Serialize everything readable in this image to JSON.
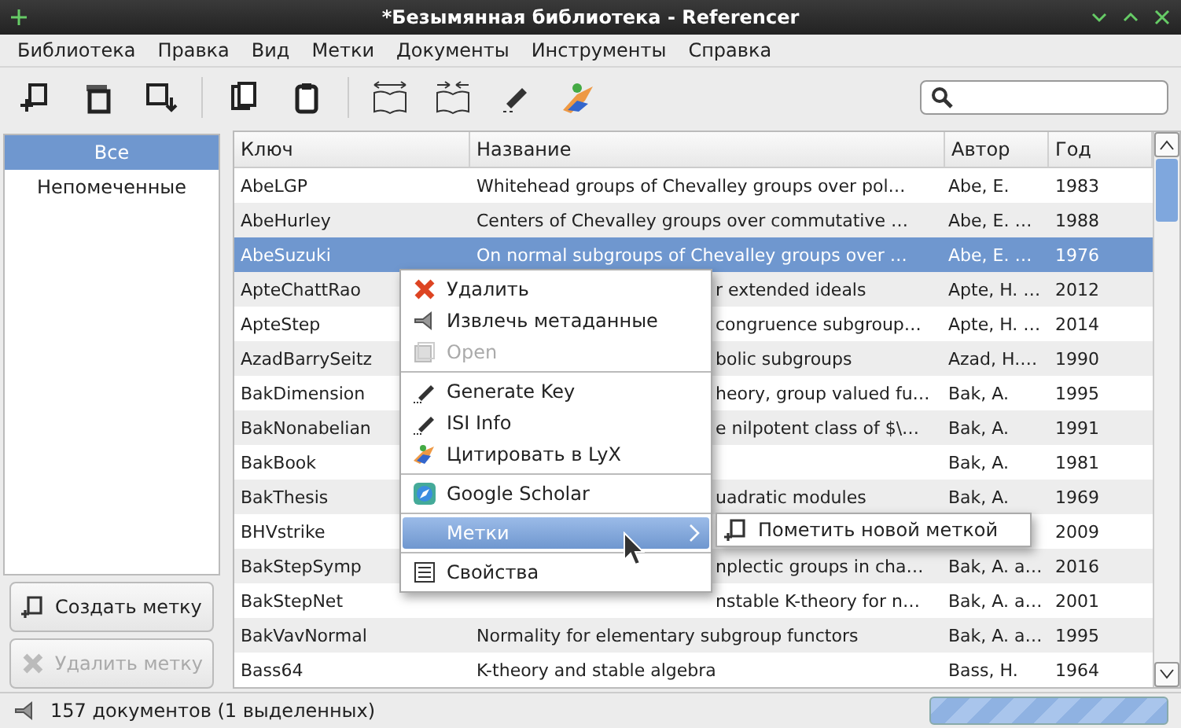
{
  "window": {
    "title": "*Безымянная библиотека - Referencer"
  },
  "menubar": [
    "Библиотека",
    "Правка",
    "Вид",
    "Метки",
    "Документы",
    "Инструменты",
    "Справка"
  ],
  "sidebar": {
    "tags": [
      {
        "label": "Все",
        "selected": true
      },
      {
        "label": "Непомеченные",
        "selected": false
      }
    ],
    "buttons": [
      {
        "label": "Создать метку",
        "kind": "add",
        "disabled": false
      },
      {
        "label": "Удалить метку",
        "kind": "delete",
        "disabled": true
      }
    ]
  },
  "table": {
    "columns": [
      "Ключ",
      "Название",
      "Автор",
      "Год"
    ],
    "rows": [
      {
        "key": "AbeLGP",
        "title": "Whitehead groups of Chevalley groups over pol…",
        "author": "Abe, E.",
        "year": "1983",
        "selected": false
      },
      {
        "key": "AbeHurley",
        "title": "Centers of Chevalley groups over commutative …",
        "author": "Abe, E. …",
        "year": "1988",
        "selected": false
      },
      {
        "key": "AbeSuzuki",
        "title": "On normal subgroups of Chevalley groups over …",
        "author": "Abe, E. …",
        "year": "1976",
        "selected": true
      },
      {
        "key": "ApteChattRao",
        "title": "r extended ideals",
        "author": "Apte, H. …",
        "year": "2012",
        "selected": false
      },
      {
        "key": "ApteStep",
        "title": "congruence subgroup…",
        "author": "Apte, H. …",
        "year": "2014",
        "selected": false
      },
      {
        "key": "AzadBarrySeitz",
        "title": "bolic subgroups",
        "author": "Azad, H.…",
        "year": "1990",
        "selected": false
      },
      {
        "key": "BakDimension",
        "title": "heory, group valued fu…",
        "author": "Bak, A.",
        "year": "1995",
        "selected": false
      },
      {
        "key": "BakNonabelian",
        "title": "e nilpotent class of $\\…",
        "author": "Bak, A.",
        "year": "1991",
        "selected": false
      },
      {
        "key": "BakBook",
        "author": "Bak, A.",
        "year": "1981",
        "selected": false
      },
      {
        "key": "BakThesis",
        "title": "uadratic modules",
        "author": "Bak, A.",
        "year": "1969",
        "selected": false
      },
      {
        "key": "BHVstrike",
        "year": "2009",
        "selected": false
      },
      {
        "key": "BakStepSymp",
        "title": "nplectic groups in cha…",
        "author": "Bak, A. a…",
        "year": "2016",
        "selected": false
      },
      {
        "key": "BakStepNet",
        "title": "nstable K-theory for n…",
        "author": "Bak, A. a…",
        "year": "2001",
        "selected": false
      },
      {
        "key": "BakVavNormal",
        "title": "Normality for elementary subgroup functors",
        "author": "Bak, A. a…",
        "year": "1995",
        "selected": false
      },
      {
        "key": "Bass64",
        "title": "K-theory and stable algebra",
        "author": "Bass, H.",
        "year": "1964",
        "selected": false
      }
    ]
  },
  "context_menu": {
    "items": [
      {
        "kind": "item",
        "label": "Удалить",
        "disabled": false,
        "selected": false
      },
      {
        "kind": "item",
        "label": "Извлечь метаданные",
        "disabled": false,
        "selected": false
      },
      {
        "kind": "item",
        "label": "Open",
        "disabled": true,
        "selected": false
      },
      {
        "kind": "separator"
      },
      {
        "kind": "item",
        "label": "Generate Key",
        "disabled": false,
        "selected": false
      },
      {
        "kind": "item",
        "label": "ISI Info",
        "disabled": false,
        "selected": false
      },
      {
        "kind": "item",
        "label": "Цитировать в LyX",
        "disabled": false,
        "selected": false
      },
      {
        "kind": "separator"
      },
      {
        "kind": "item",
        "label": "Google Scholar",
        "disabled": false,
        "selected": false
      },
      {
        "kind": "separator"
      },
      {
        "kind": "submenu",
        "label": "Метки",
        "disabled": false,
        "selected": true
      },
      {
        "kind": "separator"
      },
      {
        "kind": "item",
        "label": "Свойства",
        "disabled": false,
        "selected": false
      }
    ],
    "submenu": [
      {
        "label": "Пометить новой меткой"
      }
    ]
  },
  "status_bar": {
    "text": "157 документов (1 выделенных)"
  }
}
